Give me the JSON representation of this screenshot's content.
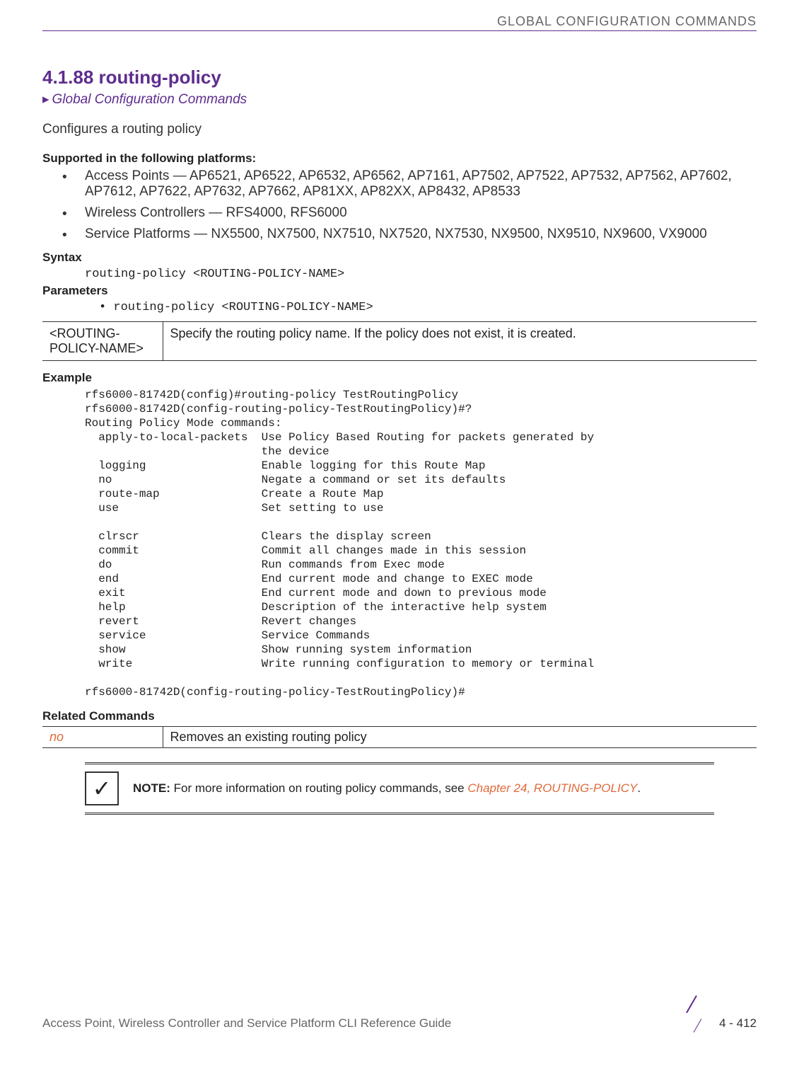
{
  "header": {
    "category": "GLOBAL CONFIGURATION COMMANDS"
  },
  "section": {
    "number_title": "4.1.88 routing-policy",
    "breadcrumb": "Global Configuration Commands",
    "intro": "Configures a routing policy"
  },
  "platforms": {
    "heading": "Supported in the following platforms:",
    "items": [
      "Access Points — AP6521, AP6522, AP6532, AP6562, AP7161, AP7502, AP7522, AP7532, AP7562, AP7602, AP7612, AP7622, AP7632, AP7662, AP81XX, AP82XX, AP8432, AP8533",
      "Wireless Controllers — RFS4000, RFS6000",
      "Service Platforms — NX5500, NX7500, NX7510, NX7520, NX7530, NX9500, NX9510, NX9600, VX9000"
    ]
  },
  "syntax": {
    "heading": "Syntax",
    "line": "routing-policy <ROUTING-POLICY-NAME>"
  },
  "parameters": {
    "heading": "Parameters",
    "bullet": "• routing-policy <ROUTING-POLICY-NAME>",
    "table": {
      "param": "<ROUTING-POLICY-NAME>",
      "desc": "Specify the routing policy name. If the policy does not exist, it is created."
    }
  },
  "example": {
    "heading": "Example",
    "block": "rfs6000-81742D(config)#routing-policy TestRoutingPolicy\nrfs6000-81742D(config-routing-policy-TestRoutingPolicy)#?\nRouting Policy Mode commands:\n  apply-to-local-packets  Use Policy Based Routing for packets generated by\n                          the device\n  logging                 Enable logging for this Route Map\n  no                      Negate a command or set its defaults\n  route-map               Create a Route Map\n  use                     Set setting to use\n\n  clrscr                  Clears the display screen\n  commit                  Commit all changes made in this session\n  do                      Run commands from Exec mode\n  end                     End current mode and change to EXEC mode\n  exit                    End current mode and down to previous mode\n  help                    Description of the interactive help system\n  revert                  Revert changes\n  service                 Service Commands\n  show                    Show running system information\n  write                   Write running configuration to memory or terminal\n\nrfs6000-81742D(config-routing-policy-TestRoutingPolicy)#"
  },
  "related": {
    "heading": "Related Commands",
    "cmd": "no",
    "desc": "Removes an existing routing policy"
  },
  "note": {
    "label": "NOTE:",
    "text_before": " For more information on routing policy commands, see ",
    "link": "Chapter 24, ROUTING-POLICY",
    "text_after": "."
  },
  "footer": {
    "guide": "Access Point, Wireless Controller and Service Platform CLI Reference Guide",
    "page": "4 - 412"
  }
}
